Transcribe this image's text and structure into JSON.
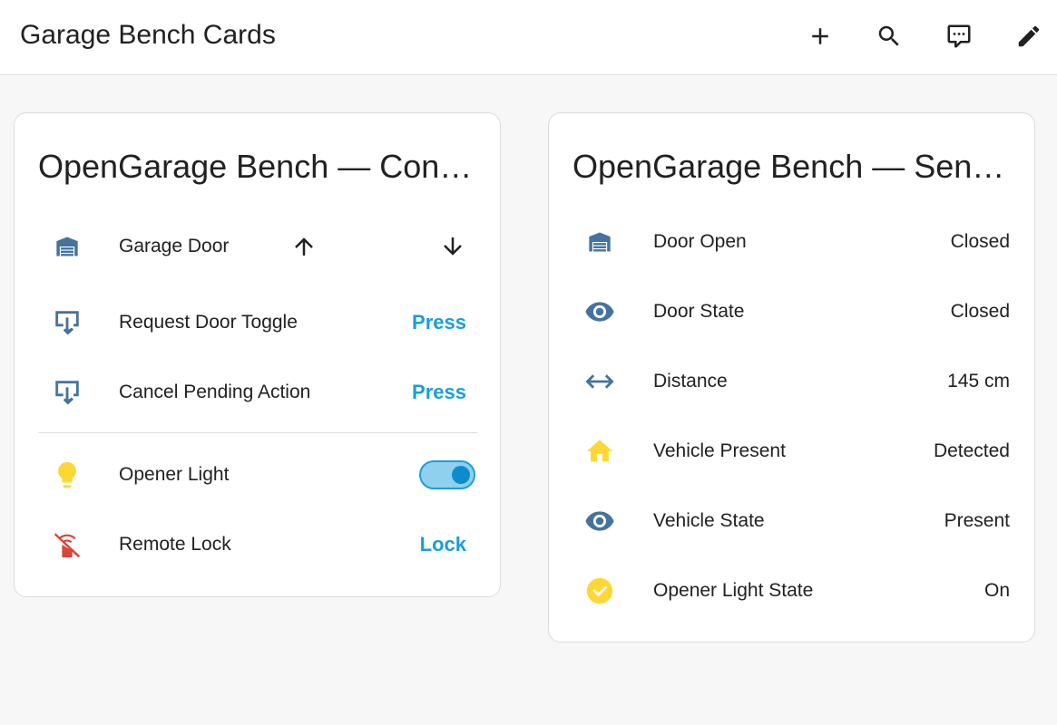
{
  "app": {
    "title": "Garage Bench Cards",
    "toolbar_icons": [
      "plus-icon",
      "search-icon",
      "chat-icon",
      "pencil-icon"
    ]
  },
  "control_card": {
    "title": "OpenGarage Bench — Cont...",
    "rows": [
      {
        "label": "Garage Door",
        "icon": "garage-icon",
        "up": "arrow-up-icon",
        "down": "arrow-down-icon"
      },
      {
        "label": "Request Door Toggle",
        "icon": "gesture-tap-icon",
        "action": "Press"
      },
      {
        "label": "Cancel Pending Action",
        "icon": "gesture-tap-icon",
        "action": "Press"
      },
      {
        "label": "Opener Light",
        "icon": "lightbulb-icon",
        "toggle_on": true
      },
      {
        "label": "Remote Lock",
        "icon": "remote-off-icon",
        "action": "Lock"
      }
    ]
  },
  "sensor_card": {
    "title": "OpenGarage Bench — Sens...",
    "rows": [
      {
        "label": "Door Open",
        "icon": "garage-icon",
        "value": "Closed"
      },
      {
        "label": "Door State",
        "icon": "eye-icon",
        "value": "Closed"
      },
      {
        "label": "Distance",
        "icon": "arrow-left-right-icon",
        "value": "145 cm"
      },
      {
        "label": "Vehicle Present",
        "icon": "home-icon",
        "value": "Detected"
      },
      {
        "label": "Vehicle State",
        "icon": "eye-icon",
        "value": "Present"
      },
      {
        "label": "Opener Light State",
        "icon": "check-circle-icon",
        "value": "On"
      }
    ]
  },
  "colors": {
    "icon_blue": "#44739e",
    "icon_yellow": "#fdd835",
    "icon_red": "#db4437",
    "accent": "#1a9fd6"
  }
}
